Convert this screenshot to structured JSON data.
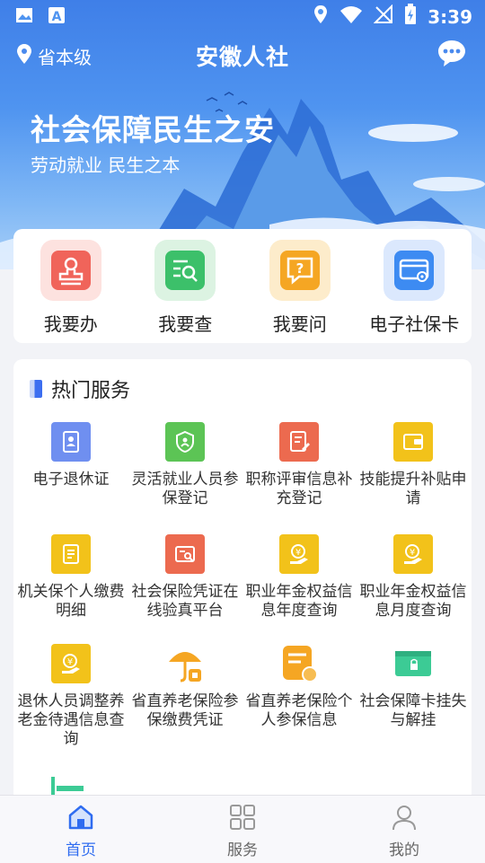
{
  "status_bar": {
    "time": "3:39"
  },
  "header": {
    "location": "省本级",
    "title": "安徽人社"
  },
  "banner": {
    "slogan": "社会保障民生之安",
    "subslogan": "劳动就业 民生之本"
  },
  "quick_actions": [
    {
      "label": "我要办",
      "icon": "stamp-icon",
      "color": "#f0645a"
    },
    {
      "label": "我要查",
      "icon": "search-list-icon",
      "color": "#3cc06a"
    },
    {
      "label": "我要问",
      "icon": "question-chat-icon",
      "color": "#f5a623"
    },
    {
      "label": "电子社保卡",
      "icon": "card-icon",
      "color": "#3d8bf2"
    }
  ],
  "hot_services": {
    "title": "热门服务",
    "items": [
      {
        "label": "电子退休证",
        "icon": "id-card-icon",
        "color": "#6f8ff0"
      },
      {
        "label": "灵活就业人员参保登记",
        "icon": "shield-person-icon",
        "color": "#5cc455"
      },
      {
        "label": "职称评审信息补充登记",
        "icon": "edit-doc-icon",
        "color": "#ec6a4f"
      },
      {
        "label": "技能提升补贴申请",
        "icon": "wallet-icon",
        "color": "#f2c21a"
      },
      {
        "label": "机关保个人缴费明细",
        "icon": "document-icon",
        "color": "#f2c21a"
      },
      {
        "label": "社会保险凭证在线验真平台",
        "icon": "verify-icon",
        "color": "#ec6a4f"
      },
      {
        "label": "职业年金权益信息年度查询",
        "icon": "coin-hand-icon",
        "color": "#f2c21a"
      },
      {
        "label": "职业年金权益信息月度查询",
        "icon": "coin-hand-icon",
        "color": "#f2c21a"
      },
      {
        "label": "退休人员调整养老金待遇信息查询",
        "icon": "coin-hand-icon",
        "color": "#f2c21a"
      },
      {
        "label": "省直养老保险参保缴费凭证",
        "icon": "umbrella-icon",
        "color": "#f5a623"
      },
      {
        "label": "省直养老保险个人参保信息",
        "icon": "doc-badge-icon",
        "color": "#f5a623"
      },
      {
        "label": "社会保障卡挂失与解挂",
        "icon": "lock-card-icon",
        "color": "#3ccb95"
      }
    ]
  },
  "tabs": [
    {
      "label": "首页",
      "icon": "home-icon",
      "active": true
    },
    {
      "label": "服务",
      "icon": "grid-icon",
      "active": false
    },
    {
      "label": "我的",
      "icon": "person-icon",
      "active": false
    }
  ]
}
